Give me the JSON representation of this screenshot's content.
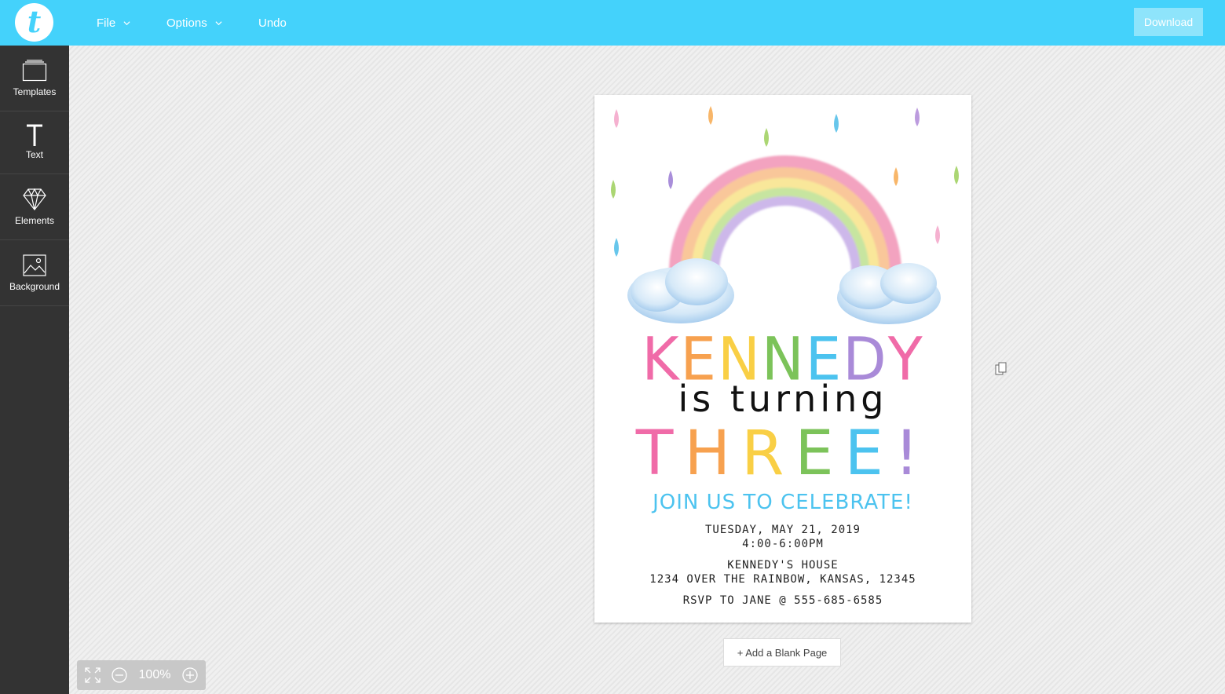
{
  "app": {
    "logo_letter": "t",
    "accent_color": "#44d2fb"
  },
  "menu": {
    "file": "File",
    "options": "Options",
    "undo": "Undo",
    "download": "Download"
  },
  "sidebar": {
    "items": [
      {
        "label": "Templates",
        "icon": "templates-icon"
      },
      {
        "label": "Text",
        "icon": "text-icon"
      },
      {
        "label": "Elements",
        "icon": "diamond-icon"
      },
      {
        "label": "Background",
        "icon": "image-icon"
      }
    ]
  },
  "invitation": {
    "name_letters": [
      {
        "ch": "K",
        "color": "#f06ba8"
      },
      {
        "ch": "E",
        "color": "#f7a14f"
      },
      {
        "ch": "N",
        "color": "#f9cf45"
      },
      {
        "ch": "N",
        "color": "#7cc35a"
      },
      {
        "ch": "E",
        "color": "#4cc3ef"
      },
      {
        "ch": "D",
        "color": "#a98ad8"
      },
      {
        "ch": "Y",
        "color": "#f06ba8"
      }
    ],
    "line2": "is turning",
    "three_letters": [
      {
        "ch": "T",
        "color": "#f06ba8"
      },
      {
        "ch": "H",
        "color": "#f7a14f"
      },
      {
        "ch": "R",
        "color": "#f9cf45"
      },
      {
        "ch": "E",
        "color": "#7cc35a"
      },
      {
        "ch": "E",
        "color": "#4cc3ef"
      },
      {
        "ch": "!",
        "color": "#a98ad8"
      }
    ],
    "celebrate": "JOIN US TO CELEBRATE!",
    "date": "TUESDAY, MAY 21, 2019",
    "time": "4:00-6:00PM",
    "place": "KENNEDY'S HOUSE",
    "address": "1234 OVER THE RAINBOW, KANSAS, 12345",
    "rsvp": "RSVP TO JANE @ 555-685-6585"
  },
  "canvas": {
    "add_page": "+ Add a Blank Page"
  },
  "zoom": {
    "level": "100%"
  }
}
